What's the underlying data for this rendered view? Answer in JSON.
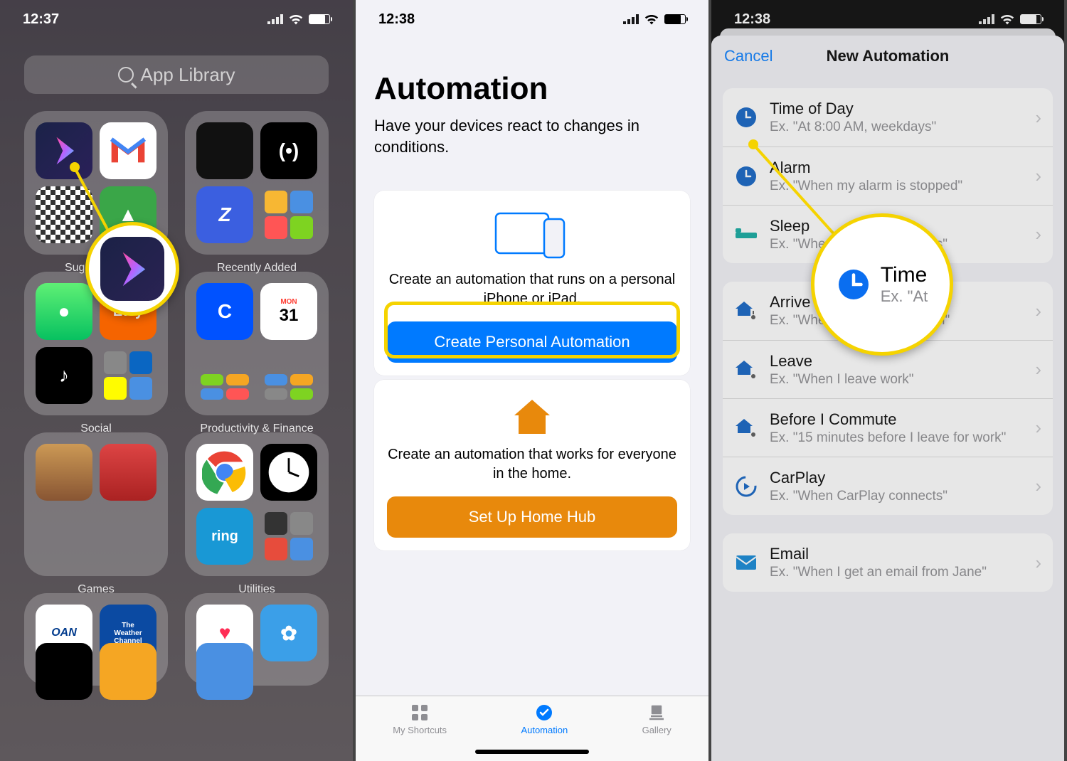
{
  "panel1": {
    "time": "12:37",
    "search_placeholder": "App Library",
    "folders": [
      {
        "label": "Suggestions"
      },
      {
        "label": "Recently Added"
      },
      {
        "label": "Social"
      },
      {
        "label": "Productivity & Finance"
      },
      {
        "label": "Games"
      },
      {
        "label": "Utilities"
      }
    ]
  },
  "panel2": {
    "time": "12:38",
    "title": "Automation",
    "subtitle": "Have your devices react to changes in conditions.",
    "card1_text": "Create an automation that runs on a personal iPhone or iPad.",
    "card1_button": "Create Personal Automation",
    "card2_text": "Create an automation that works for everyone in the home.",
    "card2_button": "Set Up Home Hub",
    "tabs": [
      {
        "label": "My Shortcuts"
      },
      {
        "label": "Automation"
      },
      {
        "label": "Gallery"
      }
    ]
  },
  "panel3": {
    "time": "12:38",
    "cancel": "Cancel",
    "title": "New Automation",
    "group1": [
      {
        "title": "Time of Day",
        "sub": "Ex. \"At 8:00 AM, weekdays\"",
        "icon": "clock"
      },
      {
        "title": "Alarm",
        "sub": "Ex. \"When my alarm is stopped\"",
        "icon": "clock"
      },
      {
        "title": "Sleep",
        "sub": "Ex. \"When Wind Down starts\"",
        "icon": "bed"
      }
    ],
    "group2": [
      {
        "title": "Arrive",
        "sub": "Ex. \"When I arrive at the gym\"",
        "icon": "house-arrive"
      },
      {
        "title": "Leave",
        "sub": "Ex. \"When I leave work\"",
        "icon": "house-leave"
      },
      {
        "title": "Before I Commute",
        "sub": "Ex. \"15 minutes before I leave for work\"",
        "icon": "house-commute"
      },
      {
        "title": "CarPlay",
        "sub": "Ex. \"When CarPlay connects\"",
        "icon": "carplay"
      }
    ],
    "group3": [
      {
        "title": "Email",
        "sub": "Ex. \"When I get an email from Jane\"",
        "icon": "mail"
      }
    ],
    "zoom": {
      "title": "Time",
      "sub": "Ex. \"At"
    }
  }
}
